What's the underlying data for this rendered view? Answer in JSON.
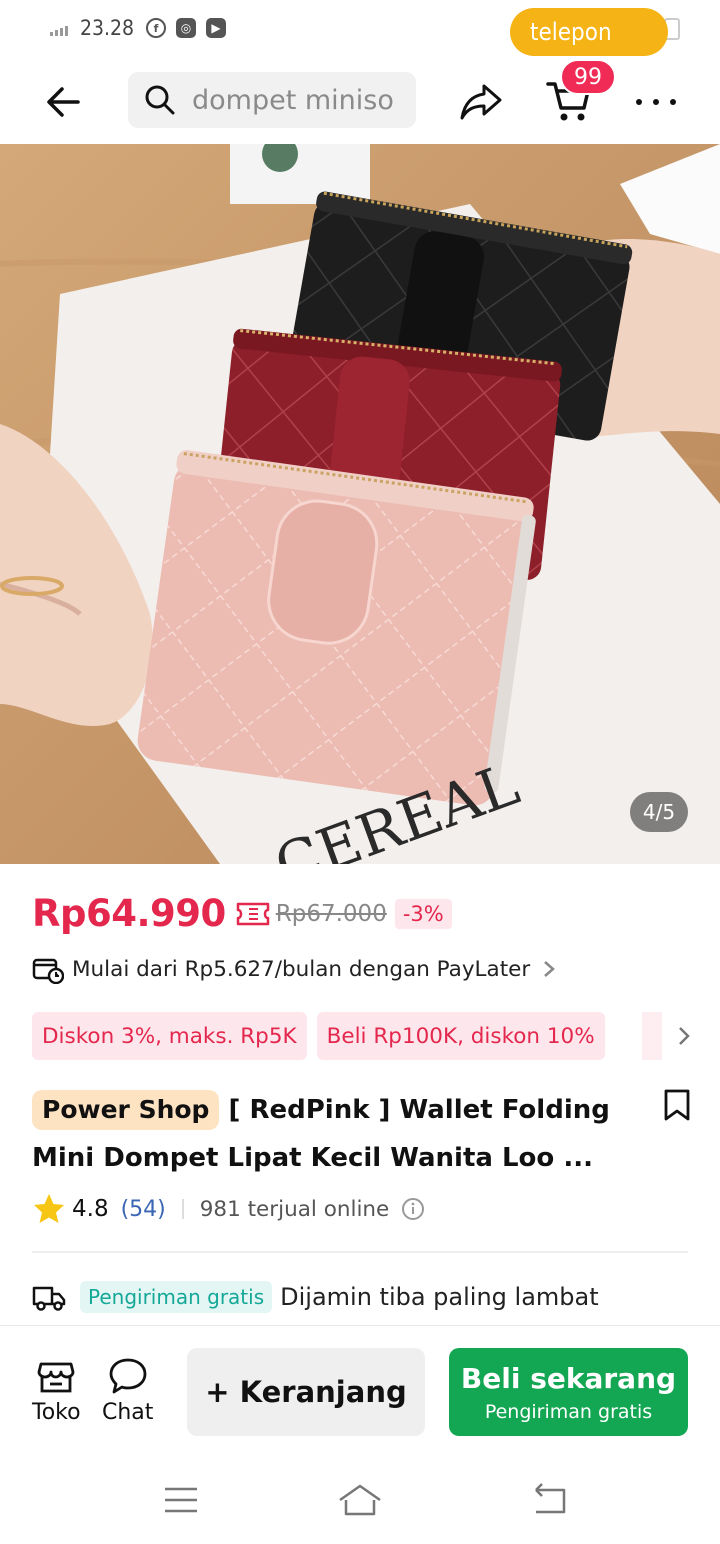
{
  "status_bar": {
    "time": "23.28",
    "call_pill": "telepon"
  },
  "nav": {
    "search_text": "dompet miniso",
    "cart_count": "99"
  },
  "gallery": {
    "counter": "4/5"
  },
  "price": {
    "current": "Rp64.990",
    "original": "Rp67.000",
    "discount": "-3%"
  },
  "paylater": {
    "text": "Mulai dari Rp5.627/bulan dengan PayLater"
  },
  "promos": [
    "Diskon 3%, maks. Rp5K",
    "Beli Rp100K, diskon 10%"
  ],
  "product": {
    "badge": "Power Shop",
    "title": "[ RedPink ] Wallet Folding Mini Dompet Lipat Kecil Wanita Loo ..."
  },
  "rating": {
    "value": "4.8",
    "count": "(54)",
    "sold": "981 terjual online"
  },
  "shipping": {
    "badge": "Pengiriman gratis",
    "text": "Dijamin tiba paling lambat"
  },
  "bottom_bar": {
    "shop_label": "Toko",
    "chat_label": "Chat",
    "add_cart_label": "+ Keranjang",
    "buy_label": "Beli sekarang",
    "buy_sub": "Pengiriman gratis"
  },
  "colors": {
    "accent_pink": "#e4274d",
    "buy_green": "#13a653",
    "pill_yellow": "#f5b316",
    "ship_teal": "#15a898"
  },
  "icons": [
    "back-arrow",
    "search",
    "share",
    "cart",
    "more",
    "voucher",
    "paylater",
    "chevron-right",
    "bookmark",
    "star",
    "info",
    "truck",
    "store",
    "chat",
    "menu",
    "home",
    "back"
  ]
}
